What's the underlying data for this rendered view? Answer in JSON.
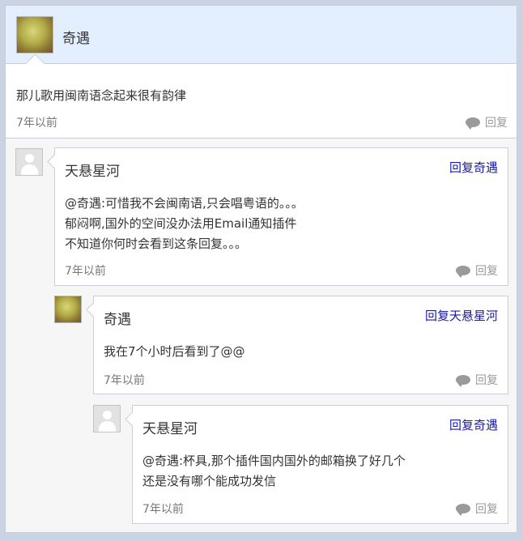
{
  "root": {
    "author": "奇遇",
    "text": "那儿歌用闽南语念起来很有韵律",
    "time": "7年以前",
    "reply_label": "回复"
  },
  "replies": [
    {
      "author": "天悬星河",
      "reply_to": "回复奇遇",
      "lines": [
        "@奇遇:可惜我不会闽南语,只会唱粤语的。。。",
        "郁闷啊,国外的空间没办法用Email通知插件",
        "不知道你何时会看到这条回复。。。"
      ],
      "time": "7年以前",
      "reply_label": "回复"
    },
    {
      "author": "奇遇",
      "reply_to": "回复天悬星河",
      "lines": [
        "我在7个小时后看到了@@"
      ],
      "time": "7年以前",
      "reply_label": "回复"
    },
    {
      "author": "天悬星河",
      "reply_to": "回复奇遇",
      "lines": [
        "@奇遇:杯具,那个插件国内国外的邮箱换了好几个",
        "还是没有哪个能成功发信"
      ],
      "time": "7年以前",
      "reply_label": "回复"
    }
  ],
  "icons": {
    "reply": "comment-bubble-icon",
    "default_avatar": "default-user-avatar-icon"
  },
  "colors": {
    "header_bg": "#e3efff",
    "link": "#1a1aa6",
    "muted": "#777777"
  }
}
